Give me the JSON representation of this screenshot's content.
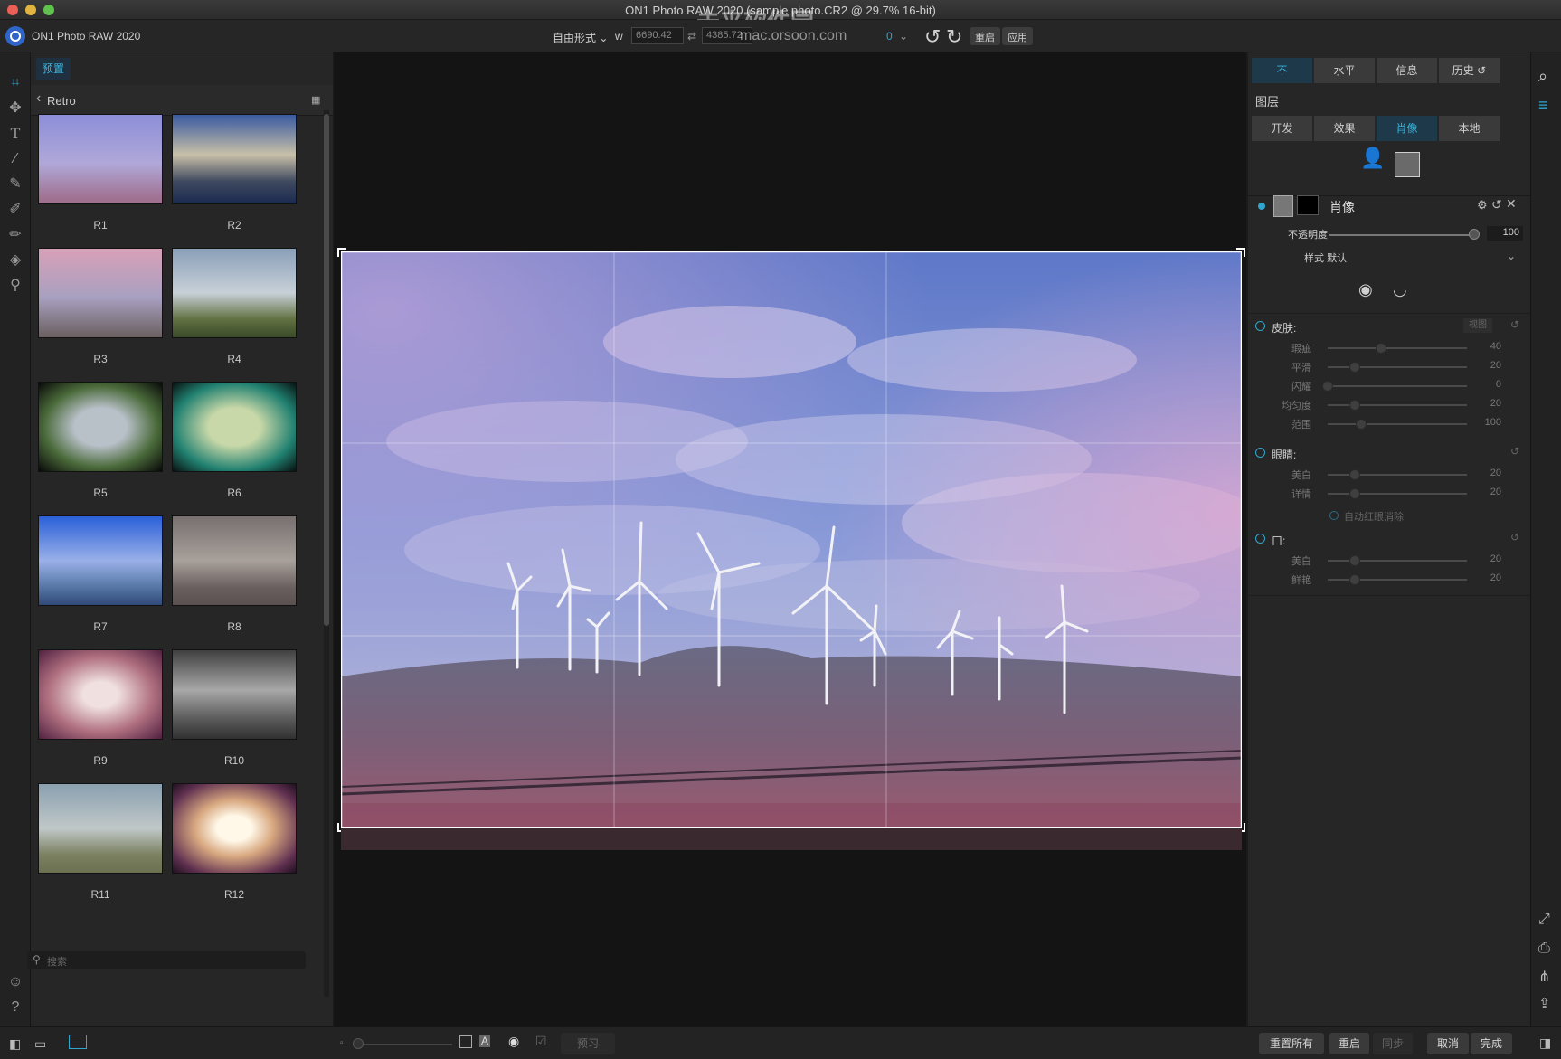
{
  "window": {
    "title": "ON1 Photo RAW 2020 (sample photo.CR2 @ 29.7% 16-bit)",
    "watermark_cn": "未来软件园",
    "watermark_url": "mac.orsoon.com"
  },
  "app": {
    "name": "ON1 Photo RAW 2020"
  },
  "toolbar": {
    "ratio_mode": "自由形式",
    "w_label": "w",
    "w_value": "6690.42",
    "h_value": "4385.72",
    "rotate_value": "0",
    "reset_label": "重启",
    "apply_label": "应用"
  },
  "browser": {
    "tab_label": "预置",
    "category": "Retro",
    "search_placeholder": "搜索",
    "presets": [
      "R1",
      "R2",
      "R3",
      "R4",
      "R5",
      "R6",
      "R7",
      "R8",
      "R9",
      "R10",
      "R11",
      "R12"
    ]
  },
  "right_panel": {
    "top_tabs": [
      "不",
      "水平",
      "信息",
      "历史"
    ],
    "layers_title": "图层",
    "module_tabs": [
      "开发",
      "效果",
      "肖像",
      "本地"
    ],
    "active_module": "肖像",
    "portrait": {
      "title": "肖像",
      "opacity_label": "不透明度",
      "opacity_value": "100",
      "style_label": "样式",
      "style_value": "默认"
    },
    "skin": {
      "title": "皮肤:",
      "view_label": "视图",
      "sliders": [
        {
          "label": "瑕疵",
          "value": "40",
          "level": 0.4
        },
        {
          "label": "平滑",
          "value": "20",
          "level": 0.2
        },
        {
          "label": "闪耀",
          "value": "0",
          "level": 0.0
        },
        {
          "label": "均匀度",
          "value": "20",
          "level": 0.2
        },
        {
          "label": "范围",
          "value": "100",
          "level": 0.25
        }
      ]
    },
    "eyes": {
      "title": "眼睛:",
      "sliders": [
        {
          "label": "美白",
          "value": "20",
          "level": 0.2
        },
        {
          "label": "详情",
          "value": "20",
          "level": 0.2
        }
      ],
      "redeye_label": "自动红眼消除"
    },
    "mouth": {
      "title": "口:",
      "sliders": [
        {
          "label": "美白",
          "value": "20",
          "level": 0.2
        },
        {
          "label": "鲜艳",
          "value": "20",
          "level": 0.2
        }
      ]
    }
  },
  "bottom": {
    "preview_label": "预习",
    "reset_all_label": "重置所有",
    "reset_label": "重启",
    "sync_label": "同步",
    "cancel_label": "取消",
    "done_label": "完成"
  },
  "colors": {
    "accent": "#2fa5d0",
    "active_tab_bg": "#1e3a4a",
    "panel_bg": "#262626",
    "canvas_bg": "#141414"
  }
}
